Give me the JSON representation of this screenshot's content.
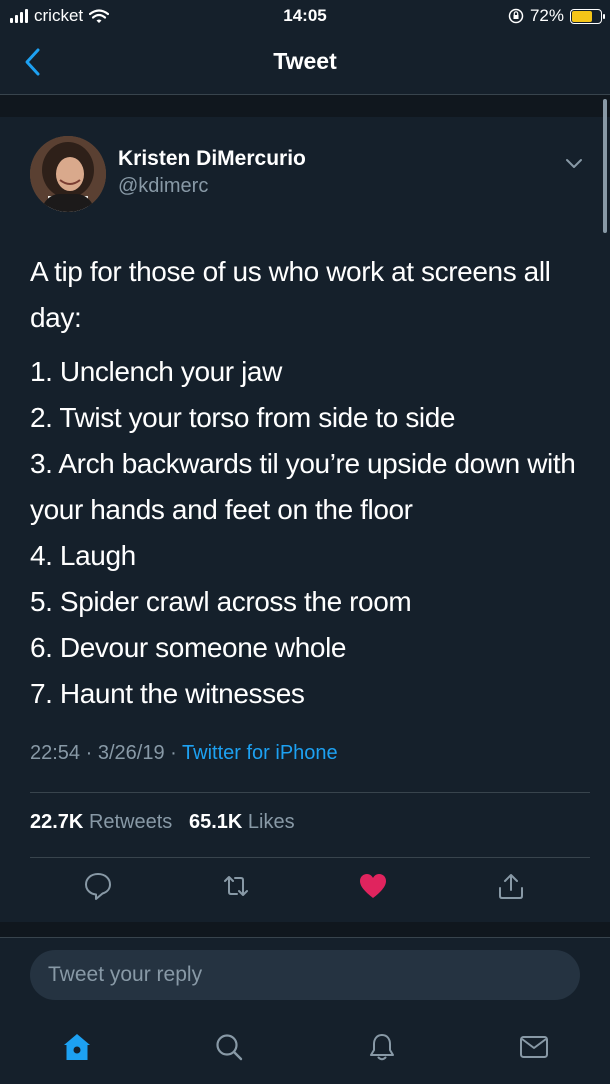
{
  "status_bar": {
    "carrier": "cricket",
    "time": "14:05",
    "battery": "72%",
    "battery_level": 0.72
  },
  "nav": {
    "title": "Tweet"
  },
  "tweet": {
    "author_name": "Kristen DiMercurio",
    "author_handle": "@kdimerc",
    "intro": "A tip for those of us who work at screens all day:",
    "lines": [
      "1. Unclench your jaw",
      "2. Twist your torso from side to side",
      "3. Arch backwards til you’re upside down with your hands and feet on the floor",
      "4. Laugh",
      "5. Spider crawl across the room",
      "6. Devour someone whole",
      "7. Haunt the witnesses"
    ],
    "time": "22:54",
    "date": "3/26/19",
    "separator": "·",
    "source": "Twitter for iPhone",
    "retweets_count": "22.7K",
    "retweets_label": "Retweets",
    "likes_count": "65.1K",
    "likes_label": "Likes",
    "liked": true
  },
  "reply": {
    "placeholder": "Tweet your reply"
  },
  "colors": {
    "background": "#15202b",
    "accent": "#1da1f2",
    "like": "#e0245e",
    "muted": "#8899a6",
    "divider": "#38444d"
  },
  "icons": {
    "actions": [
      "reply-icon",
      "retweet-icon",
      "like-icon",
      "share-icon"
    ],
    "tabs": [
      "home-icon",
      "search-icon",
      "notifications-icon",
      "messages-icon"
    ]
  }
}
